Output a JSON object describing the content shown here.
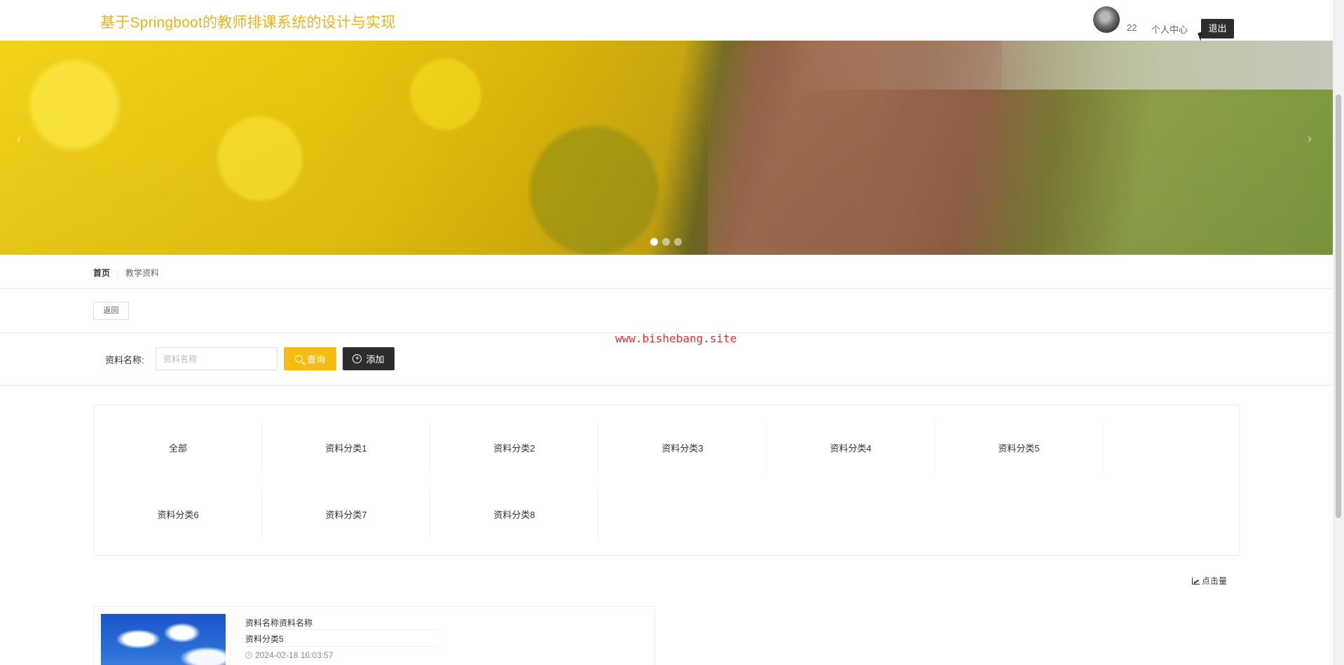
{
  "header": {
    "title": "基于Springboot的教师排课系统的设计与实现",
    "username": "22",
    "user_center": "个人中心",
    "logout": "退出"
  },
  "banner": {
    "slides": 3,
    "active_slide": 1,
    "prev": "‹",
    "next": "›"
  },
  "breadcrumb": {
    "home": "首页",
    "separator": ":",
    "current": "教学资料"
  },
  "back_label": "返回",
  "watermark": "www.bishebang.site",
  "search": {
    "label": "资料名称:",
    "placeholder": "资料名称",
    "value": "",
    "query_label": "查询",
    "add_label": "添加"
  },
  "categories": [
    "全部",
    "资料分类1",
    "资料分类2",
    "资料分类3",
    "资料分类4",
    "资料分类5",
    "资料分类6",
    "资料分类7",
    "资料分类8"
  ],
  "sort_label": "点击量",
  "items": [
    {
      "name": "资料名称资料名称",
      "category": "资料分类5",
      "time": "2024-02-18 16:03:57"
    }
  ],
  "colors": {
    "accent": "#f5bd12",
    "title": "#e8b41b",
    "dark_button": "#2d2d2d",
    "watermark": "#e03030"
  }
}
